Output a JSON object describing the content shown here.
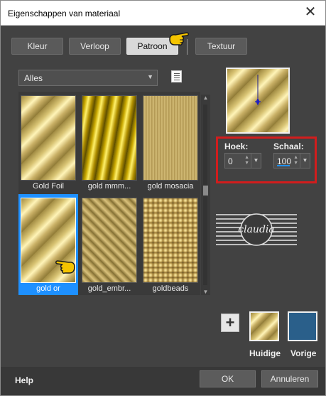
{
  "window": {
    "title": "Eigenschappen van materiaal",
    "close_glyph": "✕"
  },
  "tabs": [
    {
      "label": "Kleur",
      "active": false
    },
    {
      "label": "Verloop",
      "active": false
    },
    {
      "label": "Patroon",
      "active": true
    },
    {
      "label": "Textuur",
      "active": false
    }
  ],
  "category": {
    "selected": "Alles"
  },
  "patterns": [
    {
      "name": "Gold Foil",
      "selected": false
    },
    {
      "name": "gold mmm...",
      "selected": false
    },
    {
      "name": "gold mosacia",
      "selected": false
    },
    {
      "name": "gold or",
      "selected": true
    },
    {
      "name": "gold_embr...",
      "selected": false
    },
    {
      "name": "goldbeads",
      "selected": false
    }
  ],
  "angle": {
    "label": "Hoek:",
    "value": "0"
  },
  "scale": {
    "label": "Schaal:",
    "value": "100"
  },
  "logo": {
    "text": "claudia"
  },
  "swatches": {
    "current_label": "Huidige",
    "previous_label": "Vorige",
    "previous_color": "#2a5f8a"
  },
  "footer": {
    "help_label": "Help",
    "ok_label": "OK",
    "cancel_label": "Annuleren"
  },
  "colors": {
    "selection": "#1e90ff",
    "highlight": "#d21d1d",
    "hand": "#f5c400"
  }
}
